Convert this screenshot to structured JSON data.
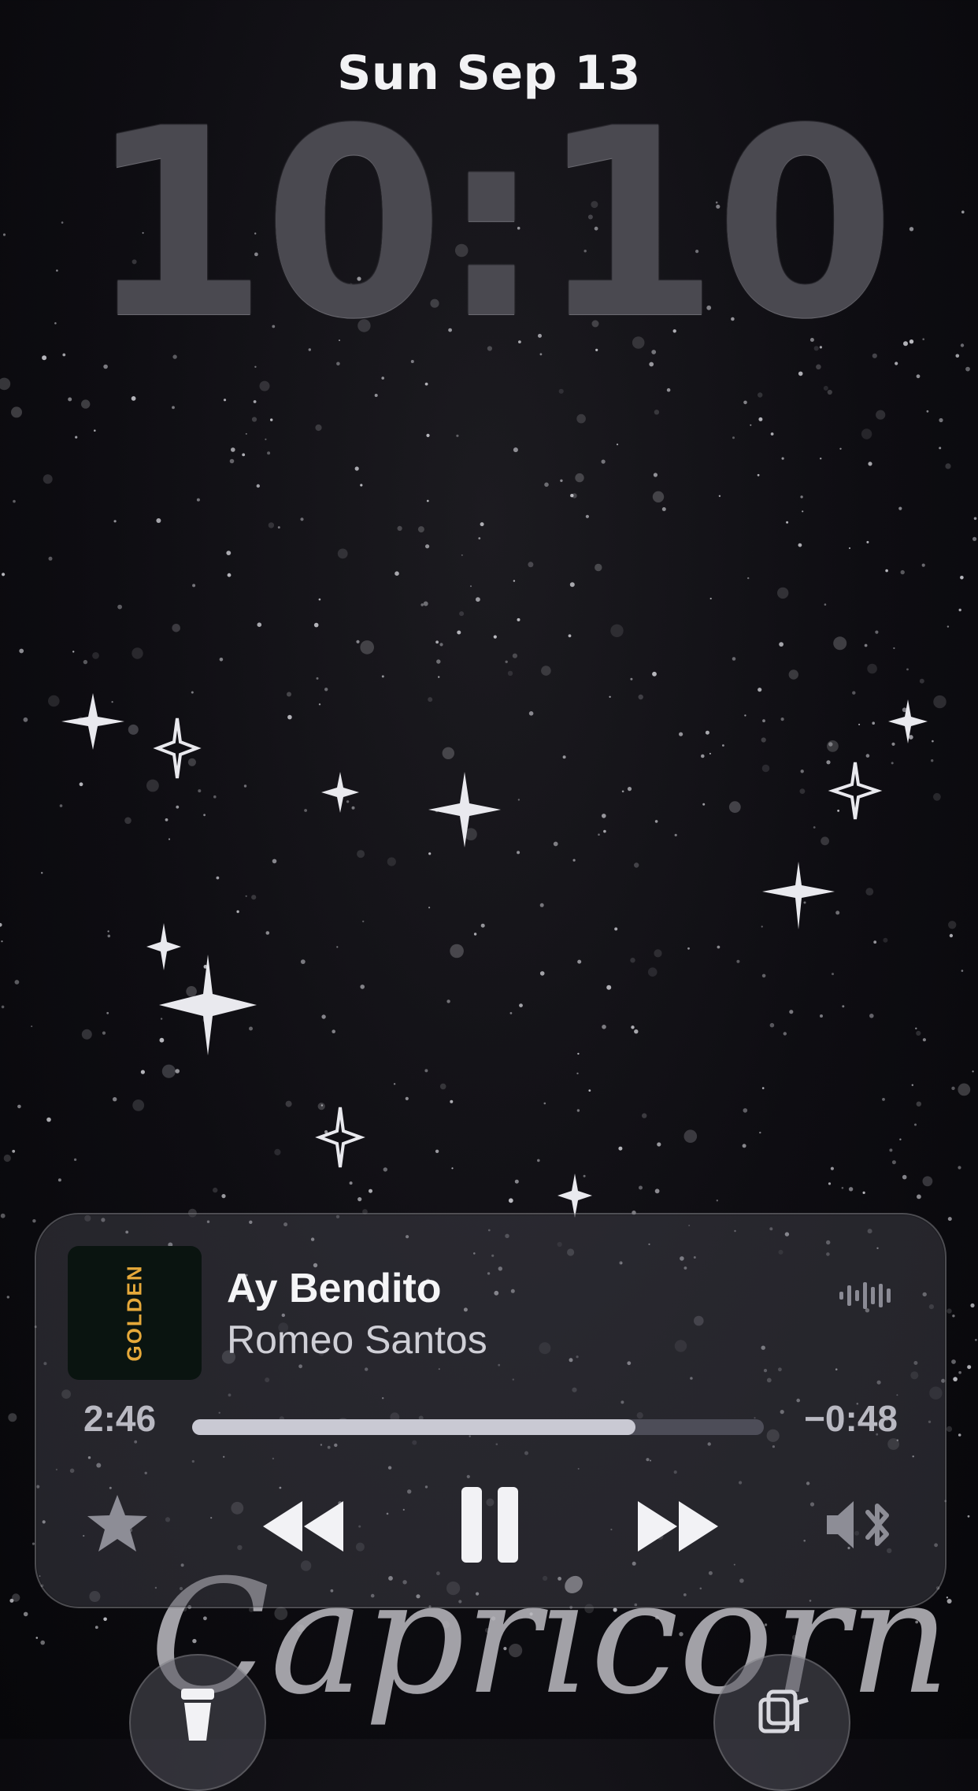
{
  "lockscreen": {
    "date": "Sun Sep 13",
    "time": "10:10",
    "wallpaper_text": "Capricorn"
  },
  "now_playing": {
    "album_art_text": "GOLDEN",
    "title": "Ay Bendito",
    "artist": "Romeo Santos",
    "elapsed": "2:46",
    "remaining": "−0:48",
    "progress": 0.776
  },
  "controls": {
    "favorite": "star-icon",
    "previous": "rewind-icon",
    "play_pause": "pause-icon",
    "next": "fast-forward-icon",
    "output": "speaker-bluetooth-icon"
  },
  "quick_actions": {
    "left": "flashlight-icon",
    "right": "music-recognition-icon"
  },
  "colors": {
    "time": "#4a4950",
    "progress_fill": "#c9c9d3",
    "progress_track": "#4d4d58",
    "album_accent": "#e6a93a"
  }
}
